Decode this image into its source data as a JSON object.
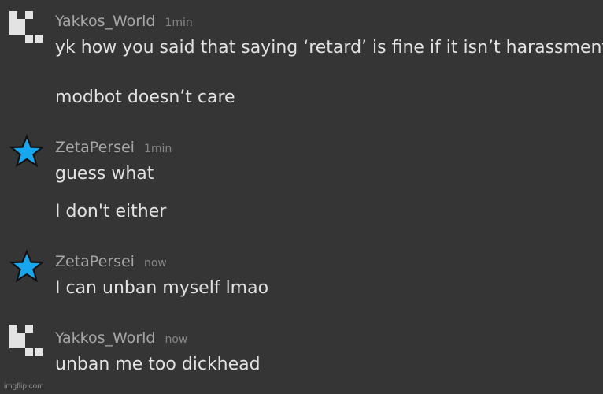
{
  "messages": [
    {
      "avatar_icon": "pixel-block-icon",
      "username": "Yakkos_World",
      "time": "1min",
      "lines": [
        "yk how you said that saying ‘retard’ is fine if it isn’t harassment",
        "modbot doesn’t care"
      ]
    },
    {
      "avatar_icon": "blue-star-icon",
      "username": "ZetaPersei",
      "time": "1min",
      "lines": [
        "guess what",
        "I don't either"
      ]
    },
    {
      "avatar_icon": "blue-star-icon",
      "username": "ZetaPersei",
      "time": "now",
      "lines": [
        "I can unban myself lmao"
      ]
    },
    {
      "avatar_icon": "pixel-block-icon",
      "username": "Yakkos_World",
      "time": "now",
      "lines": [
        "unban me too dickhead"
      ]
    }
  ],
  "watermark": "imgflip.com",
  "colors": {
    "background": "#353535",
    "star": "#18a6ef"
  }
}
